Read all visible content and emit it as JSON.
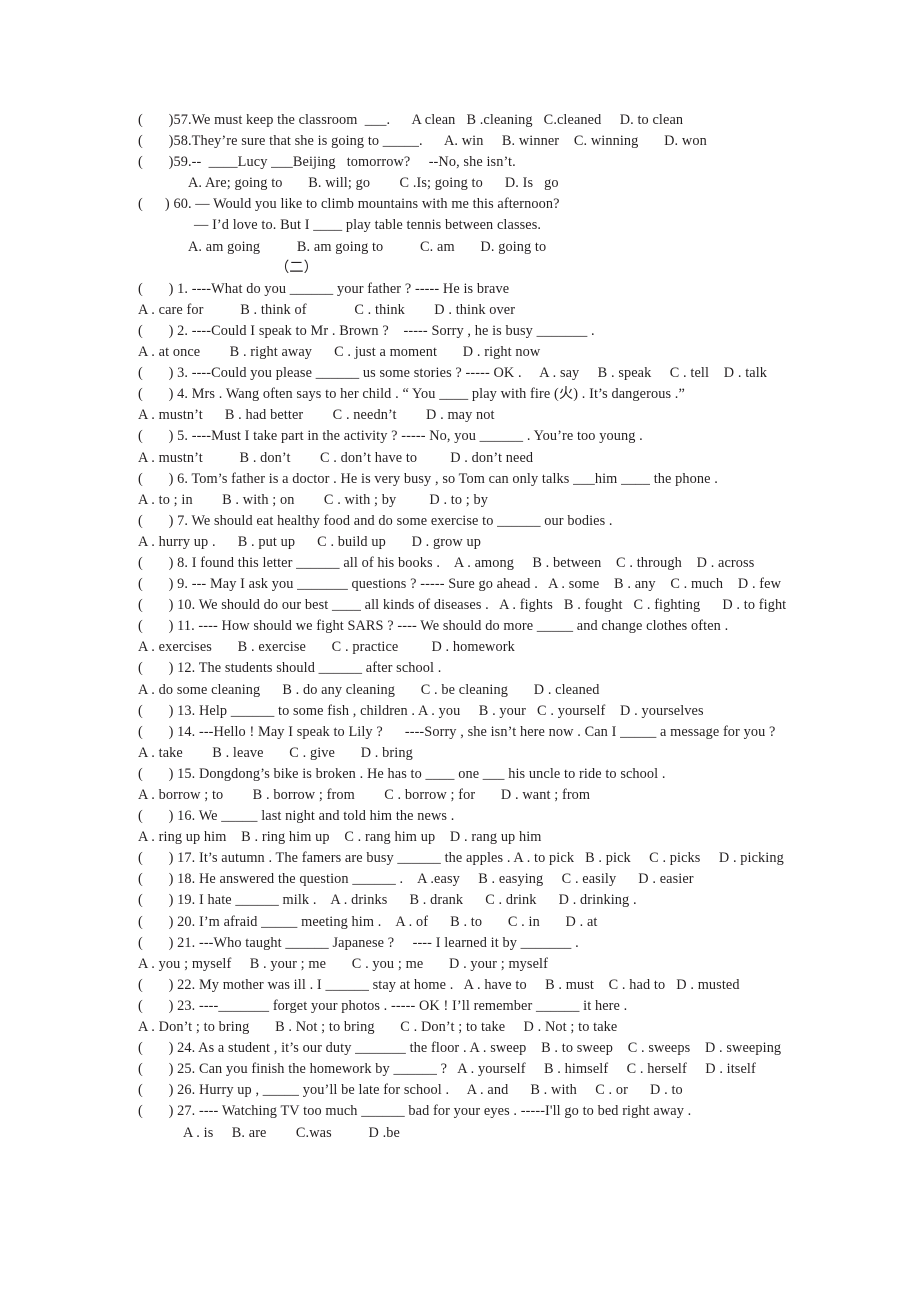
{
  "document": {
    "type": "english-grammar-worksheet",
    "text_color": "#231f20",
    "background_color": "#ffffff",
    "section_header": "（二）",
    "lines": [
      {
        "id": "q57",
        "indent": 0,
        "text": "(       )57.We must keep the classroom  ___.      A clean   B .cleaning   C.cleaned     D. to clean"
      },
      {
        "id": "q58",
        "indent": 0,
        "text": "(       )58.They’re sure that she is going to _____.      A. win     B. winner    C. winning       D. won"
      },
      {
        "id": "q59",
        "indent": 0,
        "text": "(       )59.--  ____Lucy ___Beijing   tomorrow?     --No, she isn’t."
      },
      {
        "id": "q59-opts",
        "indent": 1,
        "text": "A. Are; going to       B. will; go        C .Is; going to      D. Is   go"
      },
      {
        "id": "q60",
        "indent": 0,
        "text": "(      ) 60. — Would you like to climb mountains with me this afternoon?"
      },
      {
        "id": "q60-cont",
        "indent": 2,
        "text": "— I’d love to. But I ____ play table tennis between classes."
      },
      {
        "id": "q60-opts",
        "indent": 1,
        "text": "A. am going          B. am going to          C. am       D. going to"
      },
      {
        "id": "s2-q1",
        "indent": 0,
        "text": "(       ) 1. ----What do you ______ your father ? ----- He is brave"
      },
      {
        "id": "s2-q1-opts",
        "indent": 0,
        "text": "A . care for          B . think of             C . think        D . think over"
      },
      {
        "id": "s2-q2",
        "indent": 0,
        "text": "(       ) 2. ----Could I speak to Mr . Brown ?    ----- Sorry , he is busy _______ ."
      },
      {
        "id": "s2-q2-opts",
        "indent": 0,
        "text": "A . at once        B . right away      C . just a moment       D . right now"
      },
      {
        "id": "s2-q3",
        "indent": 0,
        "text": "(       ) 3. ----Could you please ______ us some stories ? ----- OK .     A . say     B . speak     C . tell    D . talk"
      },
      {
        "id": "s2-q4",
        "indent": 0,
        "text": "(       ) 4. Mrs . Wang often says to her child . “ You ____ play with fire (火) . It’s dangerous .”"
      },
      {
        "id": "s2-q4-opts",
        "indent": 0,
        "text": "A . mustn’t      B . had better        C . needn’t        D . may not"
      },
      {
        "id": "s2-q5",
        "indent": 0,
        "text": "(       ) 5. ----Must I take part in the activity ? ----- No, you ______ . You’re too young ."
      },
      {
        "id": "s2-q5-opts",
        "indent": 0,
        "text": "A . mustn’t          B . don’t        C . don’t have to         D . don’t need"
      },
      {
        "id": "s2-q6",
        "indent": 0,
        "text": "(       ) 6. Tom’s father is a doctor . He is very busy , so Tom can only talks ___him ____ the phone ."
      },
      {
        "id": "s2-q6-opts",
        "indent": 0,
        "text": "A . to ; in        B . with ; on        C . with ; by         D . to ; by"
      },
      {
        "id": "s2-q7",
        "indent": 0,
        "text": "(       ) 7. We should eat healthy food and do some exercise to ______ our bodies ."
      },
      {
        "id": "s2-q7-opts",
        "indent": 0,
        "text": "A . hurry up .      B . put up      C . build up       D . grow up"
      },
      {
        "id": "s2-q8",
        "indent": 0,
        "text": "(       ) 8. I found this letter ______ all of his books .    A . among     B . between    C . through    D . across"
      },
      {
        "id": "s2-q9",
        "indent": 0,
        "text": "(       ) 9. --- May I ask you _______ questions ? ----- Sure go ahead .   A . some    B . any    C . much    D . few"
      },
      {
        "id": "s2-q10",
        "indent": 0,
        "text": "(       ) 10. We should do our best ____ all kinds of diseases .   A . fights   B . fought   C . fighting      D . to fight"
      },
      {
        "id": "s2-q11",
        "indent": 0,
        "text": "(       ) 11. ---- How should we fight SARS ? ---- We should do more _____ and change clothes often ."
      },
      {
        "id": "s2-q11-opts",
        "indent": 0,
        "text": "A . exercises       B . exercise       C . practice         D . homework"
      },
      {
        "id": "s2-q12",
        "indent": 0,
        "text": "(       ) 12. The students should ______ after school ."
      },
      {
        "id": "s2-q12-opts",
        "indent": 0,
        "text": "A . do some cleaning      B . do any cleaning       C . be cleaning       D . cleaned"
      },
      {
        "id": "s2-q13",
        "indent": 0,
        "text": "(       ) 13. Help ______ to some fish , children . A . you     B . your   C . yourself    D . yourselves"
      },
      {
        "id": "s2-q14",
        "indent": 0,
        "text": "(       ) 14. ---Hello ! May I speak to Lily ?      ----Sorry , she isn’t here now . Can I _____ a message for you ?"
      },
      {
        "id": "s2-q14-opts",
        "indent": 0,
        "text": "A . take        B . leave       C . give       D . bring"
      },
      {
        "id": "s2-q15",
        "indent": 0,
        "text": "(       ) 15. Dongdong’s bike is broken . He has to ____ one ___ his uncle to ride to school ."
      },
      {
        "id": "s2-q15-opts",
        "indent": 0,
        "text": "A . borrow ; to        B . borrow ; from        C . borrow ; for       D . want ; from"
      },
      {
        "id": "s2-q16",
        "indent": 0,
        "text": "(       ) 16. We _____ last night and told him the news ."
      },
      {
        "id": "s2-q16-opts",
        "indent": 0,
        "text": "A . ring up him    B . ring him up    C . rang him up    D . rang up him"
      },
      {
        "id": "s2-q17",
        "indent": 0,
        "text": "(       ) 17. It’s autumn . The famers are busy ______ the apples . A . to pick   B . pick     C . picks     D . picking"
      },
      {
        "id": "s2-q18",
        "indent": 0,
        "text": "(       ) 18. He answered the question ______ .    A .easy     B . easying     C . easily      D . easier"
      },
      {
        "id": "s2-q19",
        "indent": 0,
        "text": "(       ) 19. I hate ______ milk .    A . drinks      B . drank      C . drink      D . drinking ."
      },
      {
        "id": "s2-q20",
        "indent": 0,
        "text": "(       ) 20. I’m afraid _____ meeting him .    A . of      B . to       C . in       D . at"
      },
      {
        "id": "s2-q21",
        "indent": 0,
        "text": "(       ) 21. ---Who taught ______ Japanese ?     ---- I learned it by _______ ."
      },
      {
        "id": "s2-q21-opts",
        "indent": 0,
        "text": "A . you ; myself     B . your ; me       C . you ; me       D . your ; myself"
      },
      {
        "id": "s2-q22",
        "indent": 0,
        "text": "(       ) 22. My mother was ill . I ______ stay at home .   A . have to     B . must    C . had to   D . musted"
      },
      {
        "id": "s2-q23",
        "indent": 0,
        "text": "(       ) 23. ----_______ forget your photos . ----- OK ! I’ll remember ______ it here ."
      },
      {
        "id": "s2-q23-opts",
        "indent": 0,
        "text": "A . Don’t ; to bring       B . Not ; to bring       C . Don’t ; to take     D . Not ; to take"
      },
      {
        "id": "s2-q24",
        "indent": 0,
        "text": "(       ) 24. As a student , it’s our duty _______ the floor . A . sweep    B . to sweep    C . sweeps    D . sweeping"
      },
      {
        "id": "s2-q25",
        "indent": 0,
        "text": "(       ) 25. Can you finish the homework by ______ ?   A . yourself     B . himself     C . herself     D . itself"
      },
      {
        "id": "s2-q26",
        "indent": 0,
        "text": "(       ) 26. Hurry up , _____ you’ll be late for school .     A . and      B . with     C . or      D . to"
      },
      {
        "id": "s2-q27",
        "indent": 0,
        "text": "(       ) 27. ---- Watching TV too much ______ bad for your eyes . -----I'll go to bed right away ."
      },
      {
        "id": "s2-q27-opts",
        "indent": 3,
        "text": "A . is     B. are        C.was          D .be"
      }
    ]
  }
}
